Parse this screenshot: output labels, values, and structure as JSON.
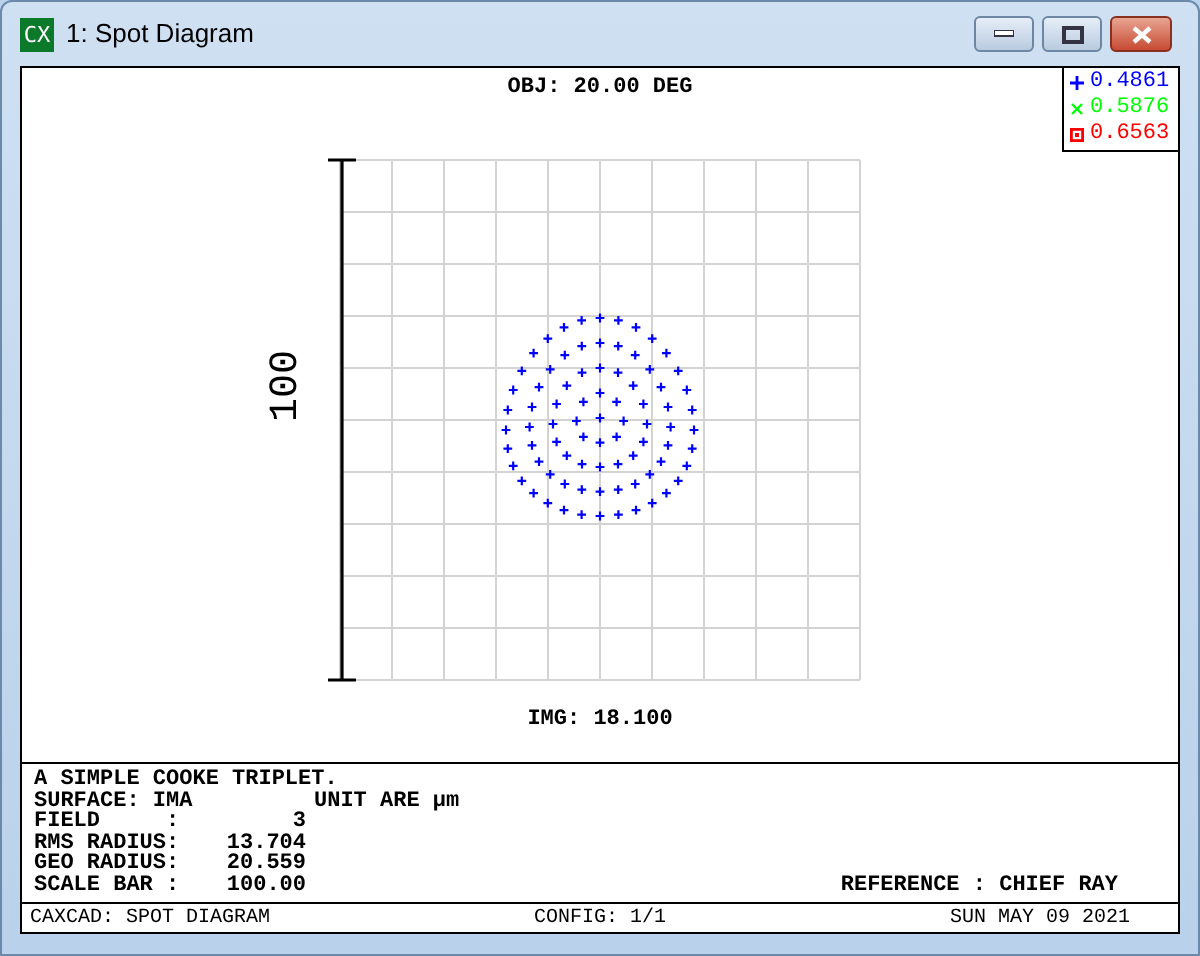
{
  "window": {
    "title": "1: Spot Diagram",
    "app_icon_text": "CX"
  },
  "legend": [
    {
      "kind": "plus",
      "wavelength": "0.4861",
      "color": "#0000ff"
    },
    {
      "kind": "cross",
      "wavelength": "0.5876",
      "color": "#00ff00"
    },
    {
      "kind": "square",
      "wavelength": "0.6563",
      "color": "#ff0000"
    }
  ],
  "plot": {
    "title": "OBJ: 20.00 DEG",
    "scale_label": "100",
    "image_label": "IMG: 18.100"
  },
  "info": {
    "heading": "A SIMPLE COOKE TRIPLET.",
    "surface": "SURFACE: IMA",
    "unit": "UNIT ARE µm",
    "rows": [
      {
        "label": "FIELD     :",
        "value": "3"
      },
      {
        "label": "RMS RADIUS:",
        "value": "13.704"
      },
      {
        "label": "GEO RADIUS:",
        "value": "20.559"
      },
      {
        "label": "SCALE BAR :",
        "value": "100.00"
      }
    ],
    "reference": "REFERENCE : CHIEF RAY"
  },
  "footer": {
    "left": "CAXCAD: SPOT DIAGRAM",
    "center": "CONFIG: 1/1",
    "right": "SUN MAY 09 2021"
  }
}
